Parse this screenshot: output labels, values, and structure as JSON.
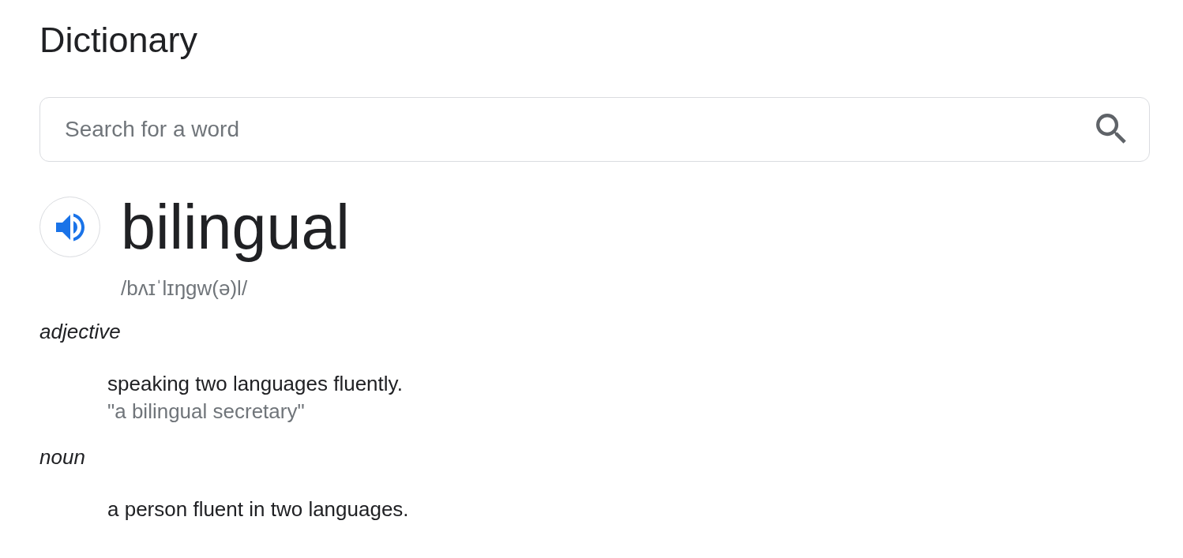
{
  "title": "Dictionary",
  "search": {
    "placeholder": "Search for a word"
  },
  "entry": {
    "word": "bilingual",
    "phonetic": "/bʌɪˈlɪŋgw(ə)l/",
    "senses": [
      {
        "part_of_speech": "adjective",
        "definitions": [
          {
            "text": "speaking two languages fluently.",
            "example": "\"a bilingual secretary\""
          }
        ]
      },
      {
        "part_of_speech": "noun",
        "definitions": [
          {
            "text": "a person fluent in two languages."
          }
        ]
      }
    ]
  }
}
